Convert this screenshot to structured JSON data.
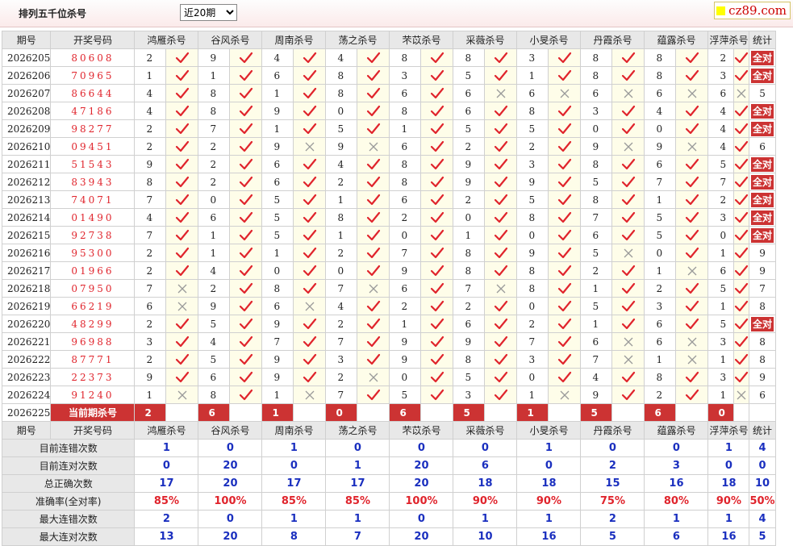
{
  "title": "排列五千位杀号",
  "period_select": {
    "selected": "近20期"
  },
  "logo_text": "cz89.com",
  "headers": [
    "期号",
    "开奖号码",
    "鸿雁杀号",
    "谷风杀号",
    "周南杀号",
    "荡之杀号",
    "芣苡杀号",
    "采薇杀号",
    "小旻杀号",
    "丹霞杀号",
    "蕴露杀号",
    "浮萍杀号",
    "统计"
  ],
  "current_label": "当前期杀号",
  "full_label": "全对",
  "rows": [
    {
      "period": "2026205",
      "win": "80608",
      "kills": [
        [
          "2",
          1
        ],
        [
          "9",
          1
        ],
        [
          "4",
          1
        ],
        [
          "4",
          1
        ],
        [
          "8",
          1
        ],
        [
          "8",
          1
        ],
        [
          "3",
          1
        ],
        [
          "8",
          1
        ],
        [
          "8",
          1
        ],
        [
          "2",
          1
        ]
      ],
      "stat": "全对"
    },
    {
      "period": "2026206",
      "win": "70965",
      "kills": [
        [
          "1",
          1
        ],
        [
          "1",
          1
        ],
        [
          "6",
          1
        ],
        [
          "8",
          1
        ],
        [
          "3",
          1
        ],
        [
          "5",
          1
        ],
        [
          "1",
          1
        ],
        [
          "8",
          1
        ],
        [
          "8",
          1
        ],
        [
          "3",
          1
        ]
      ],
      "stat": "全对"
    },
    {
      "period": "2026207",
      "win": "86644",
      "kills": [
        [
          "4",
          1
        ],
        [
          "8",
          1
        ],
        [
          "1",
          1
        ],
        [
          "8",
          1
        ],
        [
          "6",
          1
        ],
        [
          "6",
          0
        ],
        [
          "6",
          0
        ],
        [
          "6",
          0
        ],
        [
          "6",
          0
        ],
        [
          "6",
          0
        ]
      ],
      "stat": "5"
    },
    {
      "period": "2026208",
      "win": "47186",
      "kills": [
        [
          "4",
          1
        ],
        [
          "8",
          1
        ],
        [
          "9",
          1
        ],
        [
          "0",
          1
        ],
        [
          "8",
          1
        ],
        [
          "6",
          1
        ],
        [
          "8",
          1
        ],
        [
          "3",
          1
        ],
        [
          "4",
          1
        ],
        [
          "4",
          1
        ]
      ],
      "stat": "全对"
    },
    {
      "period": "2026209",
      "win": "98277",
      "kills": [
        [
          "2",
          1
        ],
        [
          "7",
          1
        ],
        [
          "1",
          1
        ],
        [
          "5",
          1
        ],
        [
          "1",
          1
        ],
        [
          "5",
          1
        ],
        [
          "5",
          1
        ],
        [
          "0",
          1
        ],
        [
          "0",
          1
        ],
        [
          "4",
          1
        ]
      ],
      "stat": "全对"
    },
    {
      "period": "2026210",
      "win": "09451",
      "kills": [
        [
          "2",
          1
        ],
        [
          "2",
          1
        ],
        [
          "9",
          0
        ],
        [
          "9",
          0
        ],
        [
          "6",
          1
        ],
        [
          "2",
          1
        ],
        [
          "2",
          1
        ],
        [
          "9",
          0
        ],
        [
          "9",
          0
        ],
        [
          "4",
          1
        ]
      ],
      "stat": "6"
    },
    {
      "period": "2026211",
      "win": "51543",
      "kills": [
        [
          "9",
          1
        ],
        [
          "2",
          1
        ],
        [
          "6",
          1
        ],
        [
          "4",
          1
        ],
        [
          "8",
          1
        ],
        [
          "9",
          1
        ],
        [
          "3",
          1
        ],
        [
          "8",
          1
        ],
        [
          "6",
          1
        ],
        [
          "5",
          1
        ]
      ],
      "stat": "全对"
    },
    {
      "period": "2026212",
      "win": "83943",
      "kills": [
        [
          "8",
          1
        ],
        [
          "2",
          1
        ],
        [
          "6",
          1
        ],
        [
          "2",
          1
        ],
        [
          "8",
          1
        ],
        [
          "9",
          1
        ],
        [
          "9",
          1
        ],
        [
          "5",
          1
        ],
        [
          "7",
          1
        ],
        [
          "7",
          1
        ]
      ],
      "stat": "全对"
    },
    {
      "period": "2026213",
      "win": "74071",
      "kills": [
        [
          "7",
          1
        ],
        [
          "0",
          1
        ],
        [
          "5",
          1
        ],
        [
          "1",
          1
        ],
        [
          "6",
          1
        ],
        [
          "2",
          1
        ],
        [
          "5",
          1
        ],
        [
          "8",
          1
        ],
        [
          "1",
          1
        ],
        [
          "2",
          1
        ]
      ],
      "stat": "全对"
    },
    {
      "period": "2026214",
      "win": "01490",
      "kills": [
        [
          "4",
          1
        ],
        [
          "6",
          1
        ],
        [
          "5",
          1
        ],
        [
          "8",
          1
        ],
        [
          "2",
          1
        ],
        [
          "0",
          1
        ],
        [
          "8",
          1
        ],
        [
          "7",
          1
        ],
        [
          "5",
          1
        ],
        [
          "3",
          1
        ]
      ],
      "stat": "全对"
    },
    {
      "period": "2026215",
      "win": "92738",
      "kills": [
        [
          "7",
          1
        ],
        [
          "1",
          1
        ],
        [
          "5",
          1
        ],
        [
          "1",
          1
        ],
        [
          "0",
          1
        ],
        [
          "1",
          1
        ],
        [
          "0",
          1
        ],
        [
          "6",
          1
        ],
        [
          "5",
          1
        ],
        [
          "0",
          1
        ]
      ],
      "stat": "全对"
    },
    {
      "period": "2026216",
      "win": "95300",
      "kills": [
        [
          "2",
          1
        ],
        [
          "1",
          1
        ],
        [
          "1",
          1
        ],
        [
          "2",
          1
        ],
        [
          "7",
          1
        ],
        [
          "8",
          1
        ],
        [
          "9",
          1
        ],
        [
          "5",
          0
        ],
        [
          "0",
          1
        ],
        [
          "1",
          1
        ]
      ],
      "stat": "9"
    },
    {
      "period": "2026217",
      "win": "01966",
      "kills": [
        [
          "2",
          1
        ],
        [
          "4",
          1
        ],
        [
          "0",
          1
        ],
        [
          "0",
          1
        ],
        [
          "9",
          1
        ],
        [
          "8",
          1
        ],
        [
          "8",
          1
        ],
        [
          "2",
          1
        ],
        [
          "1",
          0
        ],
        [
          "6",
          1
        ]
      ],
      "stat": "9"
    },
    {
      "period": "2026218",
      "win": "07950",
      "kills": [
        [
          "7",
          0
        ],
        [
          "2",
          1
        ],
        [
          "8",
          1
        ],
        [
          "7",
          0
        ],
        [
          "6",
          1
        ],
        [
          "7",
          0
        ],
        [
          "8",
          1
        ],
        [
          "1",
          1
        ],
        [
          "2",
          1
        ],
        [
          "5",
          1
        ]
      ],
      "stat": "7"
    },
    {
      "period": "2026219",
      "win": "66219",
      "kills": [
        [
          "6",
          0
        ],
        [
          "9",
          1
        ],
        [
          "6",
          0
        ],
        [
          "4",
          1
        ],
        [
          "2",
          1
        ],
        [
          "2",
          1
        ],
        [
          "0",
          1
        ],
        [
          "5",
          1
        ],
        [
          "3",
          1
        ],
        [
          "1",
          1
        ]
      ],
      "stat": "8"
    },
    {
      "period": "2026220",
      "win": "48299",
      "kills": [
        [
          "2",
          1
        ],
        [
          "5",
          1
        ],
        [
          "9",
          1
        ],
        [
          "2",
          1
        ],
        [
          "1",
          1
        ],
        [
          "6",
          1
        ],
        [
          "2",
          1
        ],
        [
          "1",
          1
        ],
        [
          "6",
          1
        ],
        [
          "5",
          1
        ]
      ],
      "stat": "全对"
    },
    {
      "period": "2026221",
      "win": "96988",
      "kills": [
        [
          "3",
          1
        ],
        [
          "4",
          1
        ],
        [
          "7",
          1
        ],
        [
          "7",
          1
        ],
        [
          "9",
          1
        ],
        [
          "9",
          1
        ],
        [
          "7",
          1
        ],
        [
          "6",
          0
        ],
        [
          "6",
          0
        ],
        [
          "3",
          1
        ]
      ],
      "stat": "8"
    },
    {
      "period": "2026222",
      "win": "87771",
      "kills": [
        [
          "2",
          1
        ],
        [
          "5",
          1
        ],
        [
          "9",
          1
        ],
        [
          "3",
          1
        ],
        [
          "9",
          1
        ],
        [
          "8",
          1
        ],
        [
          "3",
          1
        ],
        [
          "7",
          0
        ],
        [
          "1",
          0
        ],
        [
          "1",
          1
        ]
      ],
      "stat": "8"
    },
    {
      "period": "2026223",
      "win": "22373",
      "kills": [
        [
          "9",
          1
        ],
        [
          "6",
          1
        ],
        [
          "9",
          1
        ],
        [
          "2",
          0
        ],
        [
          "0",
          1
        ],
        [
          "5",
          1
        ],
        [
          "0",
          1
        ],
        [
          "4",
          1
        ],
        [
          "8",
          1
        ],
        [
          "3",
          1
        ]
      ],
      "stat": "9"
    },
    {
      "period": "2026224",
      "win": "91240",
      "kills": [
        [
          "1",
          0
        ],
        [
          "8",
          1
        ],
        [
          "1",
          0
        ],
        [
          "7",
          1
        ],
        [
          "5",
          1
        ],
        [
          "3",
          1
        ],
        [
          "1",
          0
        ],
        [
          "9",
          1
        ],
        [
          "2",
          1
        ],
        [
          "1",
          0
        ]
      ],
      "stat": "6"
    }
  ],
  "current": {
    "period": "2026225",
    "values": [
      "2",
      "6",
      "1",
      "0",
      "6",
      "5",
      "1",
      "5",
      "6",
      "0"
    ]
  },
  "summary": [
    {
      "label": "目前连错次数",
      "values": [
        "1",
        "0",
        "1",
        "0",
        "0",
        "0",
        "1",
        "0",
        "0",
        "1"
      ],
      "stat": "4",
      "kind": "val"
    },
    {
      "label": "目前连对次数",
      "values": [
        "0",
        "20",
        "0",
        "1",
        "20",
        "6",
        "0",
        "2",
        "3",
        "0"
      ],
      "stat": "0",
      "kind": "val"
    },
    {
      "label": "总正确次数",
      "values": [
        "17",
        "20",
        "17",
        "17",
        "20",
        "18",
        "18",
        "15",
        "16",
        "18"
      ],
      "stat": "10",
      "kind": "val"
    },
    {
      "label": "准确率(全对率)",
      "values": [
        "85%",
        "100%",
        "85%",
        "85%",
        "100%",
        "90%",
        "90%",
        "75%",
        "80%",
        "90%"
      ],
      "stat": "50%",
      "kind": "pct"
    },
    {
      "label": "最大连错次数",
      "values": [
        "2",
        "0",
        "1",
        "1",
        "0",
        "1",
        "1",
        "2",
        "1",
        "1"
      ],
      "stat": "4",
      "kind": "val"
    },
    {
      "label": "最大连对次数",
      "values": [
        "13",
        "20",
        "8",
        "7",
        "20",
        "10",
        "16",
        "5",
        "6",
        "16"
      ],
      "stat": "5",
      "kind": "val"
    }
  ],
  "icons": {
    "check": "check-icon",
    "cross": "cross-icon"
  }
}
